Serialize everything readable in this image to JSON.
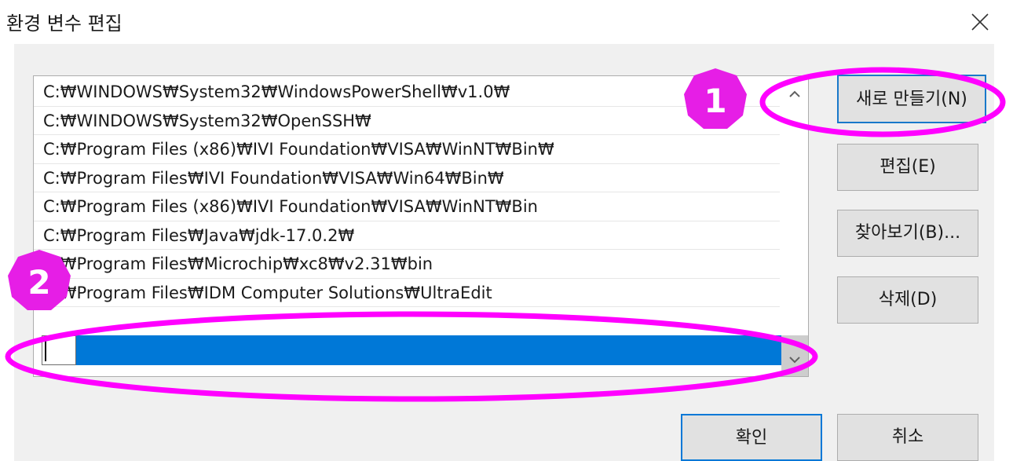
{
  "window": {
    "title": "환경 변수 편집",
    "close_icon": "close-icon"
  },
  "path_list": {
    "items": [
      "C:₩WINDOWS₩System32₩WindowsPowerShell₩v1.0₩",
      "C:₩WINDOWS₩System32₩OpenSSH₩",
      "C:₩Program Files (x86)₩IVI Foundation₩VISA₩WinNT₩Bin₩",
      "C:₩Program Files₩IVI Foundation₩VISA₩Win64₩Bin₩",
      "C:₩Program Files (x86)₩IVI Foundation₩VISA₩WinNT₩Bin",
      "C:₩Program Files₩Java₩jdk-17.0.2₩",
      "C:₩Program Files₩Microchip₩xc8₩v2.31₩bin",
      "C:₩Program Files₩IDM Computer Solutions₩UltraEdit"
    ],
    "new_entry_value": "",
    "selection_color": "#0078d7"
  },
  "buttons": {
    "new": "새로 만들기(N)",
    "edit": "편집(E)",
    "browse": "찾아보기(B)...",
    "delete": "삭제(D)",
    "ok": "확인",
    "cancel": "취소"
  },
  "annotations": {
    "badge_1": "1",
    "badge_2": "2",
    "highlight_color": "#ff00ff"
  }
}
